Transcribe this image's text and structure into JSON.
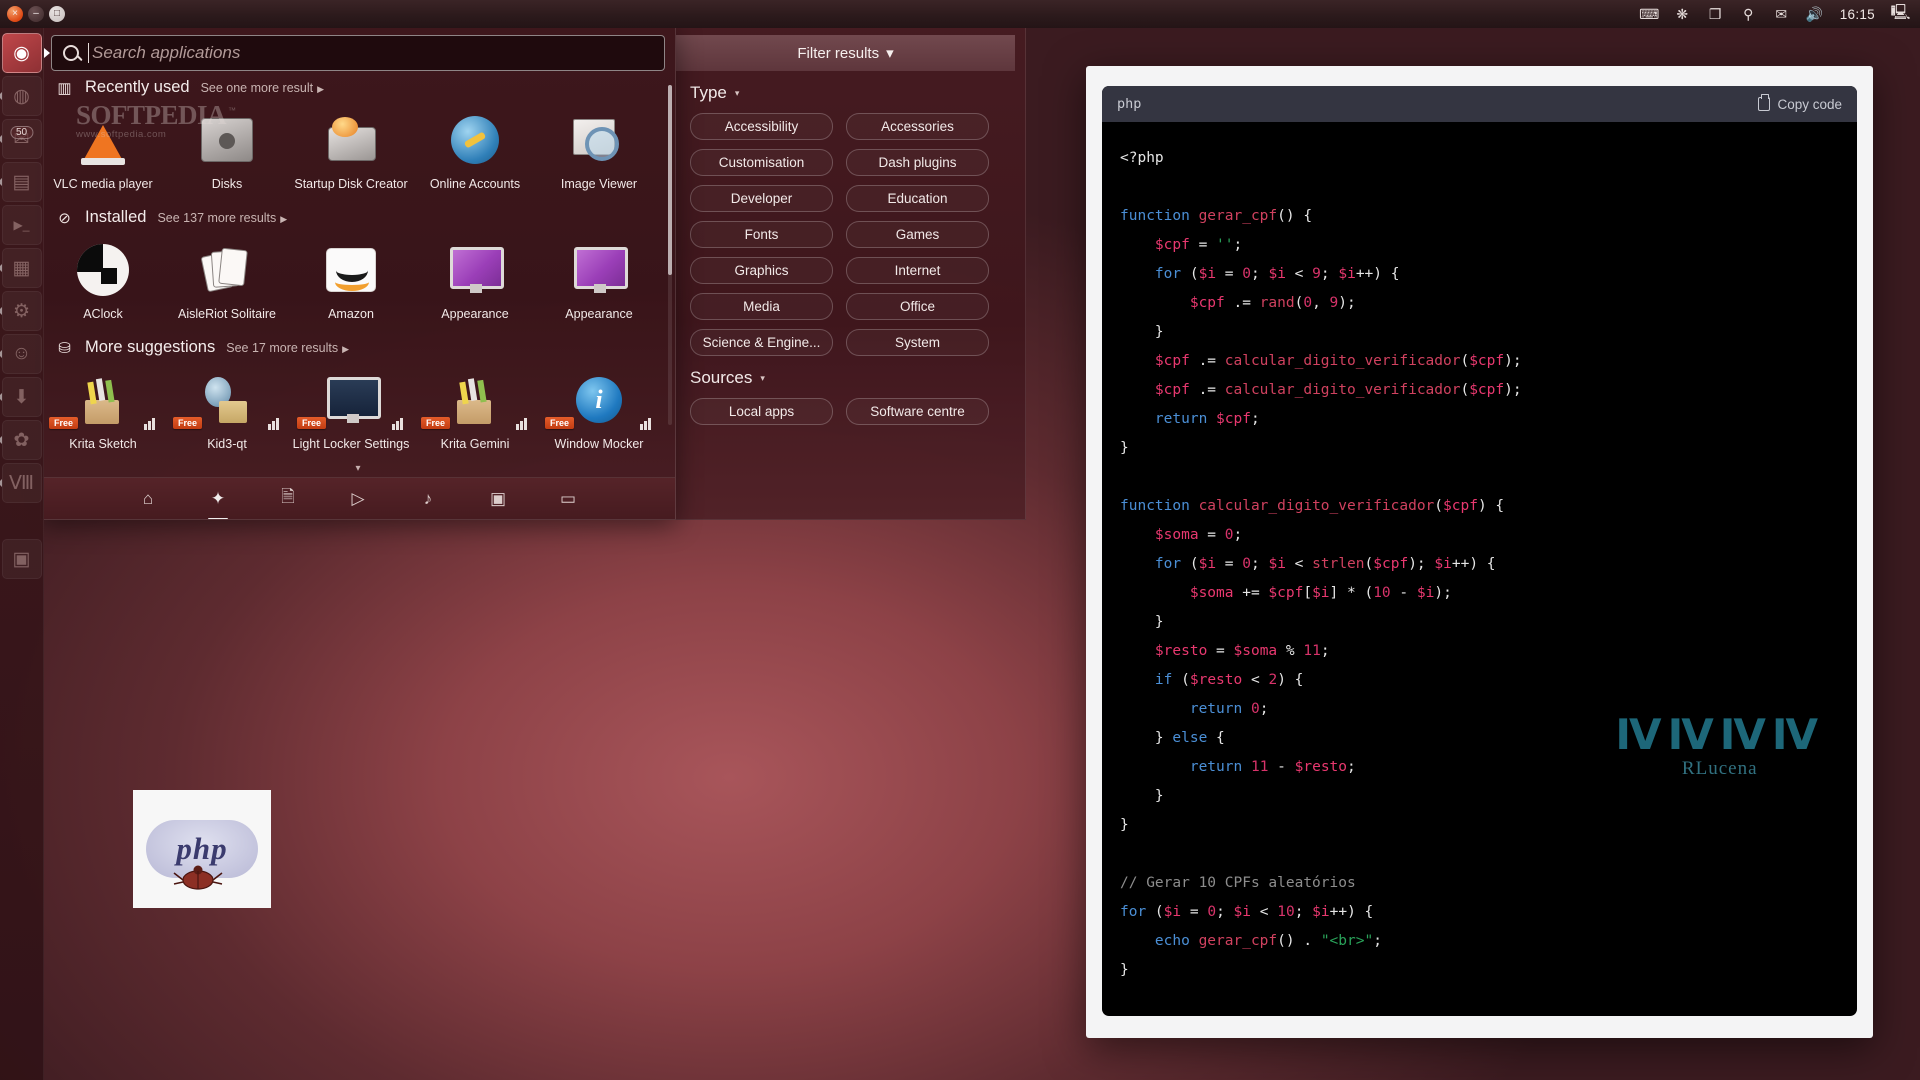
{
  "top_panel": {
    "window_buttons": [
      "×",
      "–",
      "□"
    ],
    "tray_icons": [
      "ibus-indicator-icon",
      "bluetooth-icon",
      "dropbox-icon",
      "vpn-icon",
      "mail-icon",
      "volume-icon"
    ],
    "clock": "16:15",
    "session_icon": "display-icon"
  },
  "launcher": {
    "items": [
      {
        "name": "ubuntu-dash-home",
        "glyph": "◉",
        "active": true,
        "running": false,
        "count": ""
      },
      {
        "name": "firefox",
        "glyph": "◍",
        "active": false,
        "running": true,
        "count": ""
      },
      {
        "name": "thunderbird",
        "glyph": "✉",
        "active": false,
        "running": true,
        "count": "50"
      },
      {
        "name": "files-nautilus",
        "glyph": "▤",
        "active": false,
        "running": true,
        "count": ""
      },
      {
        "name": "terminal",
        "glyph": "▶_",
        "active": false,
        "running": false,
        "count": ""
      },
      {
        "name": "libreoffice-writer",
        "glyph": "▦",
        "active": false,
        "running": true,
        "count": ""
      },
      {
        "name": "system-settings",
        "glyph": "⚙",
        "active": false,
        "running": true,
        "count": ""
      },
      {
        "name": "empathy-chat",
        "glyph": "☺",
        "active": false,
        "running": true,
        "count": ""
      },
      {
        "name": "software-updater",
        "glyph": "⬇",
        "active": false,
        "running": true,
        "count": ""
      },
      {
        "name": "gimp",
        "glyph": "✿",
        "active": false,
        "running": true,
        "count": ""
      },
      {
        "name": "vmware",
        "glyph": "Ⅷ",
        "active": false,
        "running": true,
        "count": ""
      },
      {
        "name": "workspace-switcher",
        "glyph": "▣",
        "active": false,
        "running": false,
        "count": ""
      }
    ]
  },
  "dash": {
    "search": {
      "placeholder": "Search applications",
      "value": ""
    },
    "watermark": {
      "main": "SOFTPEDIA",
      "sub": "www.softpedia.com",
      "tm": "™"
    },
    "sections": [
      {
        "icon": "recently-used-icon",
        "title": "Recently used",
        "more_label": "See one more result",
        "apps": [
          {
            "name": "VLC media player",
            "icon": "vlc-cone-icon",
            "free": false
          },
          {
            "name": "Disks",
            "icon": "disks-icon",
            "free": false
          },
          {
            "name": "Startup Disk Creator",
            "icon": "startup-disk-icon",
            "free": false
          },
          {
            "name": "Online Accounts",
            "icon": "online-accounts-icon",
            "free": false
          },
          {
            "name": "Image Viewer",
            "icon": "image-viewer-icon",
            "free": false
          }
        ]
      },
      {
        "icon": "installed-icon",
        "title": "Installed",
        "more_label": "See 137 more results",
        "apps": [
          {
            "name": "AClock",
            "icon": "aclock-icon",
            "free": false
          },
          {
            "name": "AisleRiot Solitaire",
            "icon": "solitaire-icon",
            "free": false
          },
          {
            "name": "Amazon",
            "icon": "amazon-icon",
            "free": false
          },
          {
            "name": "Appearance",
            "icon": "appearance-icon",
            "free": false
          },
          {
            "name": "Appearance",
            "icon": "appearance-icon",
            "free": false
          }
        ]
      },
      {
        "icon": "more-suggestions-icon",
        "title": "More suggestions",
        "more_label": "See 17 more results",
        "apps": [
          {
            "name": "Krita Sketch",
            "icon": "krita-icon",
            "free": true,
            "price_label": "Free"
          },
          {
            "name": "Kid3-qt",
            "icon": "kid3-icon",
            "free": true,
            "price_label": "Free"
          },
          {
            "name": "Light Locker Settings",
            "icon": "light-locker-icon",
            "free": true,
            "price_label": "Free"
          },
          {
            "name": "Krita Gemini",
            "icon": "krita-icon",
            "free": true,
            "price_label": "Free"
          },
          {
            "name": "Window Mocker",
            "icon": "window-mocker-icon",
            "free": true,
            "price_label": "Free"
          }
        ]
      }
    ],
    "bottom_bar": [
      {
        "name": "dash-home-lens",
        "glyph": "⌂",
        "selected": false
      },
      {
        "name": "dash-applications-lens",
        "glyph": "✦",
        "selected": true
      },
      {
        "name": "dash-files-lens",
        "glyph": "🗎",
        "selected": false
      },
      {
        "name": "dash-video-lens",
        "glyph": "▷",
        "selected": false
      },
      {
        "name": "dash-music-lens",
        "glyph": "♪",
        "selected": false
      },
      {
        "name": "dash-photos-lens",
        "glyph": "▣",
        "selected": false
      },
      {
        "name": "dash-messages-lens",
        "glyph": "▭",
        "selected": false
      }
    ],
    "collapse_glyph": "▾"
  },
  "filter": {
    "header_label": "Filter results",
    "header_caret": "▾",
    "groups": [
      {
        "title": "Type",
        "caret": "▾",
        "buttons": [
          "Accessibility",
          "Accessories",
          "Customisation",
          "Dash plugins",
          "Developer",
          "Education",
          "Fonts",
          "Games",
          "Graphics",
          "Internet",
          "Media",
          "Office",
          "Science & Engine...",
          "System"
        ]
      },
      {
        "title": "Sources",
        "caret": "▾",
        "buttons": [
          "Local apps",
          "Software centre"
        ]
      }
    ]
  },
  "code_window": {
    "language_label": "php",
    "copy_label": "Copy code",
    "copy_icon": "clipboard-icon",
    "code_lines": [
      [
        {
          "t": "plain",
          "v": "<?php"
        }
      ],
      [
        {
          "t": "plain",
          "v": ""
        }
      ],
      [
        {
          "t": "kw",
          "v": "function"
        },
        {
          "t": "plain",
          "v": " "
        },
        {
          "t": "fn",
          "v": "gerar_cpf"
        },
        {
          "t": "plain",
          "v": "() {"
        }
      ],
      [
        {
          "t": "plain",
          "v": "    "
        },
        {
          "t": "var",
          "v": "$cpf"
        },
        {
          "t": "plain",
          "v": " = "
        },
        {
          "t": "str",
          "v": "''"
        },
        {
          "t": "plain",
          "v": ";"
        }
      ],
      [
        {
          "t": "plain",
          "v": "    "
        },
        {
          "t": "kw",
          "v": "for"
        },
        {
          "t": "plain",
          "v": " ("
        },
        {
          "t": "var",
          "v": "$i"
        },
        {
          "t": "plain",
          "v": " = "
        },
        {
          "t": "num",
          "v": "0"
        },
        {
          "t": "plain",
          "v": "; "
        },
        {
          "t": "var",
          "v": "$i"
        },
        {
          "t": "plain",
          "v": " < "
        },
        {
          "t": "num",
          "v": "9"
        },
        {
          "t": "plain",
          "v": "; "
        },
        {
          "t": "var",
          "v": "$i"
        },
        {
          "t": "plain",
          "v": "++) {"
        }
      ],
      [
        {
          "t": "plain",
          "v": "        "
        },
        {
          "t": "var",
          "v": "$cpf"
        },
        {
          "t": "plain",
          "v": " .= "
        },
        {
          "t": "fn",
          "v": "rand"
        },
        {
          "t": "plain",
          "v": "("
        },
        {
          "t": "num",
          "v": "0"
        },
        {
          "t": "plain",
          "v": ", "
        },
        {
          "t": "num",
          "v": "9"
        },
        {
          "t": "plain",
          "v": ");"
        }
      ],
      [
        {
          "t": "plain",
          "v": "    }"
        }
      ],
      [
        {
          "t": "plain",
          "v": "    "
        },
        {
          "t": "var",
          "v": "$cpf"
        },
        {
          "t": "plain",
          "v": " .= "
        },
        {
          "t": "fn",
          "v": "calcular_digito_verificador"
        },
        {
          "t": "plain",
          "v": "("
        },
        {
          "t": "var",
          "v": "$cpf"
        },
        {
          "t": "plain",
          "v": ");"
        }
      ],
      [
        {
          "t": "plain",
          "v": "    "
        },
        {
          "t": "var",
          "v": "$cpf"
        },
        {
          "t": "plain",
          "v": " .= "
        },
        {
          "t": "fn",
          "v": "calcular_digito_verificador"
        },
        {
          "t": "plain",
          "v": "("
        },
        {
          "t": "var",
          "v": "$cpf"
        },
        {
          "t": "plain",
          "v": ");"
        }
      ],
      [
        {
          "t": "plain",
          "v": "    "
        },
        {
          "t": "kw",
          "v": "return"
        },
        {
          "t": "plain",
          "v": " "
        },
        {
          "t": "var",
          "v": "$cpf"
        },
        {
          "t": "plain",
          "v": ";"
        }
      ],
      [
        {
          "t": "plain",
          "v": "}"
        }
      ],
      [
        {
          "t": "plain",
          "v": ""
        }
      ],
      [
        {
          "t": "kw",
          "v": "function"
        },
        {
          "t": "plain",
          "v": " "
        },
        {
          "t": "fn",
          "v": "calcular_digito_verificador"
        },
        {
          "t": "plain",
          "v": "("
        },
        {
          "t": "var",
          "v": "$cpf"
        },
        {
          "t": "plain",
          "v": ") {"
        }
      ],
      [
        {
          "t": "plain",
          "v": "    "
        },
        {
          "t": "var",
          "v": "$soma"
        },
        {
          "t": "plain",
          "v": " = "
        },
        {
          "t": "num",
          "v": "0"
        },
        {
          "t": "plain",
          "v": ";"
        }
      ],
      [
        {
          "t": "plain",
          "v": "    "
        },
        {
          "t": "kw",
          "v": "for"
        },
        {
          "t": "plain",
          "v": " ("
        },
        {
          "t": "var",
          "v": "$i"
        },
        {
          "t": "plain",
          "v": " = "
        },
        {
          "t": "num",
          "v": "0"
        },
        {
          "t": "plain",
          "v": "; "
        },
        {
          "t": "var",
          "v": "$i"
        },
        {
          "t": "plain",
          "v": " < "
        },
        {
          "t": "fn",
          "v": "strlen"
        },
        {
          "t": "plain",
          "v": "("
        },
        {
          "t": "var",
          "v": "$cpf"
        },
        {
          "t": "plain",
          "v": "); "
        },
        {
          "t": "var",
          "v": "$i"
        },
        {
          "t": "plain",
          "v": "++) {"
        }
      ],
      [
        {
          "t": "plain",
          "v": "        "
        },
        {
          "t": "var",
          "v": "$soma"
        },
        {
          "t": "plain",
          "v": " += "
        },
        {
          "t": "var",
          "v": "$cpf"
        },
        {
          "t": "plain",
          "v": "["
        },
        {
          "t": "var",
          "v": "$i"
        },
        {
          "t": "plain",
          "v": "] * ("
        },
        {
          "t": "num",
          "v": "10"
        },
        {
          "t": "plain",
          "v": " - "
        },
        {
          "t": "var",
          "v": "$i"
        },
        {
          "t": "plain",
          "v": ");"
        }
      ],
      [
        {
          "t": "plain",
          "v": "    }"
        }
      ],
      [
        {
          "t": "plain",
          "v": "    "
        },
        {
          "t": "var",
          "v": "$resto"
        },
        {
          "t": "plain",
          "v": " = "
        },
        {
          "t": "var",
          "v": "$soma"
        },
        {
          "t": "plain",
          "v": " % "
        },
        {
          "t": "num",
          "v": "11"
        },
        {
          "t": "plain",
          "v": ";"
        }
      ],
      [
        {
          "t": "plain",
          "v": "    "
        },
        {
          "t": "kw",
          "v": "if"
        },
        {
          "t": "plain",
          "v": " ("
        },
        {
          "t": "var",
          "v": "$resto"
        },
        {
          "t": "plain",
          "v": " < "
        },
        {
          "t": "num",
          "v": "2"
        },
        {
          "t": "plain",
          "v": ") {"
        }
      ],
      [
        {
          "t": "plain",
          "v": "        "
        },
        {
          "t": "kw",
          "v": "return"
        },
        {
          "t": "plain",
          "v": " "
        },
        {
          "t": "num",
          "v": "0"
        },
        {
          "t": "plain",
          "v": ";"
        }
      ],
      [
        {
          "t": "plain",
          "v": "    } "
        },
        {
          "t": "kw",
          "v": "else"
        },
        {
          "t": "plain",
          "v": " {"
        }
      ],
      [
        {
          "t": "plain",
          "v": "        "
        },
        {
          "t": "kw",
          "v": "return"
        },
        {
          "t": "plain",
          "v": " "
        },
        {
          "t": "num",
          "v": "11"
        },
        {
          "t": "plain",
          "v": " - "
        },
        {
          "t": "var",
          "v": "$resto"
        },
        {
          "t": "plain",
          "v": ";"
        }
      ],
      [
        {
          "t": "plain",
          "v": "    }"
        }
      ],
      [
        {
          "t": "plain",
          "v": "}"
        }
      ],
      [
        {
          "t": "plain",
          "v": ""
        }
      ],
      [
        {
          "t": "cmt",
          "v": "// Gerar 10 CPFs aleatórios"
        }
      ],
      [
        {
          "t": "kw",
          "v": "for"
        },
        {
          "t": "plain",
          "v": " ("
        },
        {
          "t": "var",
          "v": "$i"
        },
        {
          "t": "plain",
          "v": " = "
        },
        {
          "t": "num",
          "v": "0"
        },
        {
          "t": "plain",
          "v": "; "
        },
        {
          "t": "var",
          "v": "$i"
        },
        {
          "t": "plain",
          "v": " < "
        },
        {
          "t": "num",
          "v": "10"
        },
        {
          "t": "plain",
          "v": "; "
        },
        {
          "t": "var",
          "v": "$i"
        },
        {
          "t": "plain",
          "v": "++) {"
        }
      ],
      [
        {
          "t": "plain",
          "v": "    "
        },
        {
          "t": "kw",
          "v": "echo"
        },
        {
          "t": "plain",
          "v": " "
        },
        {
          "t": "fn",
          "v": "gerar_cpf"
        },
        {
          "t": "plain",
          "v": "() . "
        },
        {
          "t": "str",
          "v": "\"<br>\""
        },
        {
          "t": "plain",
          "v": ";"
        }
      ],
      [
        {
          "t": "plain",
          "v": "}"
        }
      ],
      [
        {
          "t": "plain",
          "v": ""
        }
      ],
      [
        {
          "t": "plain",
          "v": "?>"
        }
      ]
    ]
  },
  "watermark": {
    "glyph": "ⅣⅣⅣⅣ",
    "name": "RLucena"
  },
  "desktop": {
    "php_thumb_label": "php"
  },
  "colors": {
    "ubuntu_aubergine": "#2c0e14",
    "ubuntu_orange": "#dd4814",
    "dash_bg": "#3e171c",
    "code_bg": "#000000",
    "code_header": "#343541",
    "watermark_cyan": "#2fa6c4"
  }
}
